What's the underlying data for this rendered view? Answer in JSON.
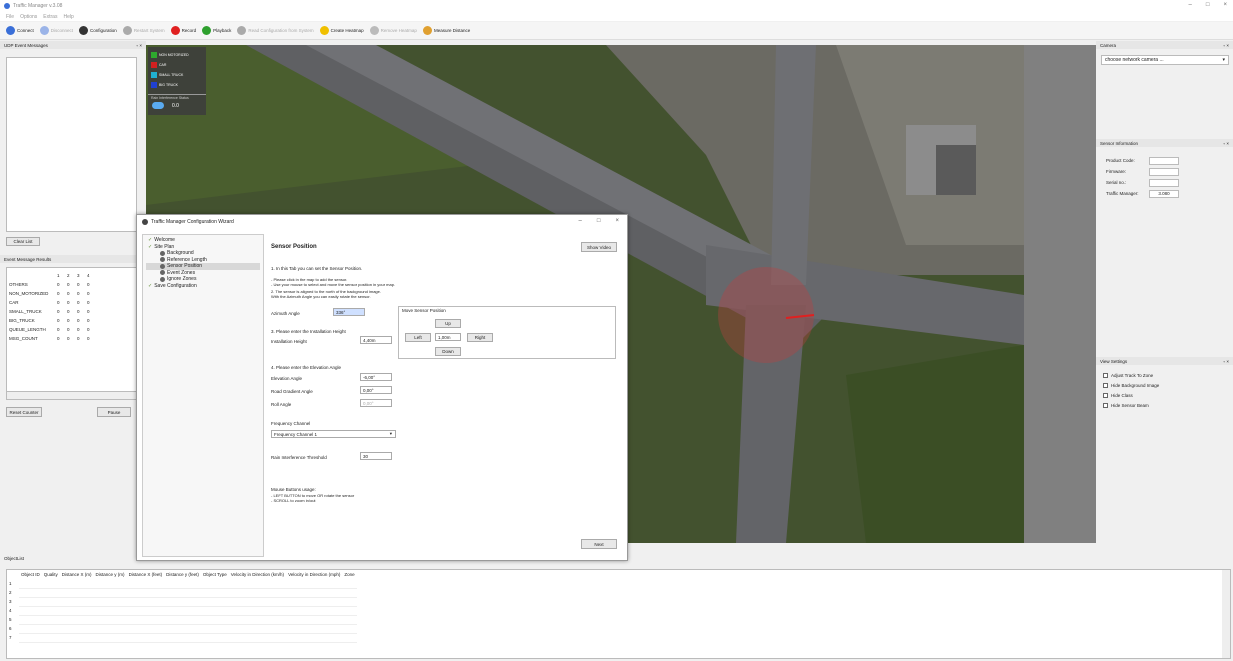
{
  "app": {
    "title": "Traffic Manager v.3.08",
    "menus": [
      "File",
      "Options",
      "Extras",
      "Help"
    ],
    "win_controls": [
      "–",
      "□",
      "×"
    ]
  },
  "toolbar": [
    {
      "label": "Connect",
      "icon": "plug-icon",
      "color": "#3a6fd8",
      "enabled": true
    },
    {
      "label": "Disconnect",
      "icon": "unplug-icon",
      "color": "#9bb4e8",
      "enabled": false
    },
    {
      "label": "Configuration",
      "icon": "gear-icon",
      "color": "#333333",
      "enabled": true
    },
    {
      "label": "Restart System",
      "icon": "restart-icon",
      "color": "#aaaaaa",
      "enabled": false
    },
    {
      "label": "Record",
      "icon": "record-icon",
      "color": "#e02020",
      "enabled": true
    },
    {
      "label": "Playback",
      "icon": "play-icon",
      "color": "#2ea02e",
      "enabled": true
    },
    {
      "label": "Read Configuration from System",
      "icon": "read-config-icon",
      "color": "#aaaaaa",
      "enabled": false
    },
    {
      "label": "Create Heatmap",
      "icon": "heatmap-icon",
      "color": "#f0c000",
      "enabled": true
    },
    {
      "label": "Remove Heatmap",
      "icon": "remove-heatmap-icon",
      "color": "#bbbbbb",
      "enabled": false
    },
    {
      "label": "Measure Distance",
      "icon": "ruler-icon",
      "color": "#e0a030",
      "enabled": true
    }
  ],
  "udp": {
    "title": "UDP Event Messages",
    "clear": "Clear List"
  },
  "results": {
    "title": "Event Message Results",
    "cols": [
      "",
      "1",
      "2",
      "3",
      "4"
    ],
    "rows": [
      [
        "OTHERS",
        "0",
        "0",
        "0",
        "0"
      ],
      [
        "NON_MOTORIZED",
        "0",
        "0",
        "0",
        "0"
      ],
      [
        "CAR",
        "0",
        "0",
        "0",
        "0"
      ],
      [
        "SMALL_TRUCK",
        "0",
        "0",
        "0",
        "0"
      ],
      [
        "BIG_TRUCK",
        "0",
        "0",
        "0",
        "0"
      ],
      [
        "QUEUE_LENGTH",
        "0",
        "0",
        "0",
        "0"
      ],
      [
        "MSG_COUNT",
        "0",
        "0",
        "0",
        "0"
      ]
    ],
    "reset": "Reset Counter",
    "pause": "Pause"
  },
  "legend": [
    {
      "label": "NON MOTORIZED",
      "color": "#2eaa2e"
    },
    {
      "label": "CAR",
      "color": "#d02020"
    },
    {
      "label": "SMALL TRUCK",
      "color": "#20b0d0"
    },
    {
      "label": "BIG TRUCK",
      "color": "#2040d0"
    }
  ],
  "rain": {
    "title": "Rain Interference Status",
    "value": "0.0"
  },
  "camera": {
    "title": "Camera",
    "select": "choose network camera ..."
  },
  "sensor": {
    "title": "Sensor Information",
    "fields": [
      {
        "label": "Product Code:",
        "value": ""
      },
      {
        "label": "Firmware:",
        "value": ""
      },
      {
        "label": "Serial no.:",
        "value": ""
      },
      {
        "label": "Traffic Manager:",
        "value": "3.080"
      }
    ]
  },
  "view": {
    "title": "View Settings",
    "options": [
      "Adjust Track To Zone",
      "Hide Background Image",
      "Hide Class",
      "Hide Sensor Beam"
    ]
  },
  "objects": {
    "title": "ObjectList",
    "cols": [
      "Object ID",
      "Quality",
      "Distance X (m)",
      "Distance y (m)",
      "Distance X (feet)",
      "Distance y (feet)",
      "Object Type",
      "Velocity in Direction (km/h)",
      "Velocity in Direction (mph)",
      "Zone"
    ],
    "rows": [
      "1",
      "2",
      "3",
      "4",
      "5",
      "6",
      "7"
    ]
  },
  "wizard": {
    "title": "Traffic Manager Configuration Wizard",
    "tree": [
      {
        "label": "Welcome",
        "lvl": 1,
        "icon": "check-icon"
      },
      {
        "label": "Site Plan",
        "lvl": 1,
        "icon": "check-icon"
      },
      {
        "label": "Background",
        "lvl": 2,
        "icon": "dot-icon"
      },
      {
        "label": "Reference Length",
        "lvl": 2,
        "icon": "dot-icon"
      },
      {
        "label": "Sensor Position",
        "lvl": 2,
        "icon": "dot-icon"
      },
      {
        "label": "Event Zones",
        "lvl": 2,
        "icon": "dot-icon"
      },
      {
        "label": "Ignore Zones",
        "lvl": 2,
        "icon": "dot-icon"
      },
      {
        "label": "Save Configuration",
        "lvl": 1,
        "icon": "check-icon"
      }
    ],
    "heading": "Sensor Position",
    "show_video": "Show Video",
    "step1": "1. In this Tab you can set the Sensor Position.",
    "hint1": "- Please click in the map to add the sensor.",
    "hint2": "- Use your mouse to select and move the sensor position in your map.",
    "step2": "2. The sensor is aligned to the north of the background image.",
    "step2b": "With the Azimuth Angle you can easily rotate the sensor.",
    "azimuth_label": "Azimuth Angle",
    "azimuth": "336°",
    "move_title": "Move Sensor Position",
    "up": "Up",
    "left": "Left",
    "step": "1,00m",
    "right": "Right",
    "down": "Down",
    "step3": "3. Please enter the Installation Height",
    "height_label": "Installation Height",
    "height": "4,40m",
    "step4": "4. Please enter the Elevation Angle",
    "elev_label": "Elevation Angle",
    "elev": "-6,00°",
    "road_label": "Road Gradient Angle",
    "road": "0,00°",
    "roll_label": "Roll Angle",
    "roll": "0,00°",
    "freq_label": "Frequency Channel",
    "freq": "Frequency Channel 1",
    "rain_label": "Rain Interference Threshold",
    "rain": "30",
    "mouse_title": "Mouse Buttons usage:",
    "mouse1": "- LEFT BUTTON to move OR rotate the sensor",
    "mouse2": "- SCROLL to zoom in/out",
    "next": "Next"
  }
}
